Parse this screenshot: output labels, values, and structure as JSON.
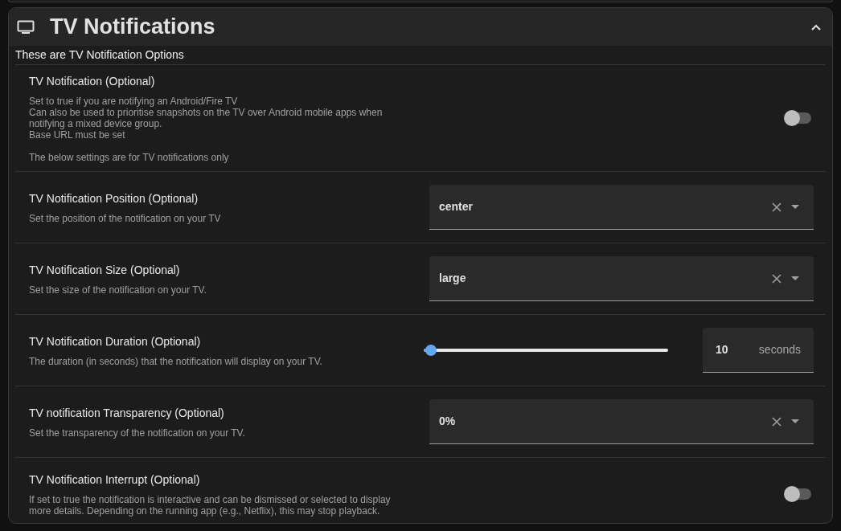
{
  "section": {
    "title": "TV Notifications",
    "expanded": true,
    "subtitle": "These are TV Notification Options"
  },
  "rows": [
    {
      "kind": "toggle",
      "label": "TV Notification (Optional)",
      "description": "Set to true if you are notifying an Android/Fire TV\nCan also be used to prioritise snapshots on the TV over Android mobile apps when notifying a mixed device group.\nBase URL must be set\n\nThe below settings are for TV notifications only",
      "on": false
    },
    {
      "kind": "select",
      "label": "TV Notification Position (Optional)",
      "description": "Set the position of the notification on your TV",
      "value": "center"
    },
    {
      "kind": "select",
      "label": "TV Notification Size (Optional)",
      "description": "Set the size of the notification on your TV.",
      "value": "large"
    },
    {
      "kind": "slider",
      "label": "TV Notification Duration (Optional)",
      "description": "The duration (in seconds) that the notification will display on your TV.",
      "level": 0.03,
      "value": "10",
      "unit": "seconds"
    },
    {
      "kind": "select",
      "label": "TV notification Transparency (Optional)",
      "description": "Set the transparency of the notification on your TV.",
      "value": "0%"
    },
    {
      "kind": "toggle",
      "label": "TV Notification Interrupt (Optional)",
      "description": "If set to true the notification is interactive and can be dismissed or selected to display more details. Depending on the running app (e.g., Netflix), this may stop playback.",
      "on": false
    }
  ]
}
